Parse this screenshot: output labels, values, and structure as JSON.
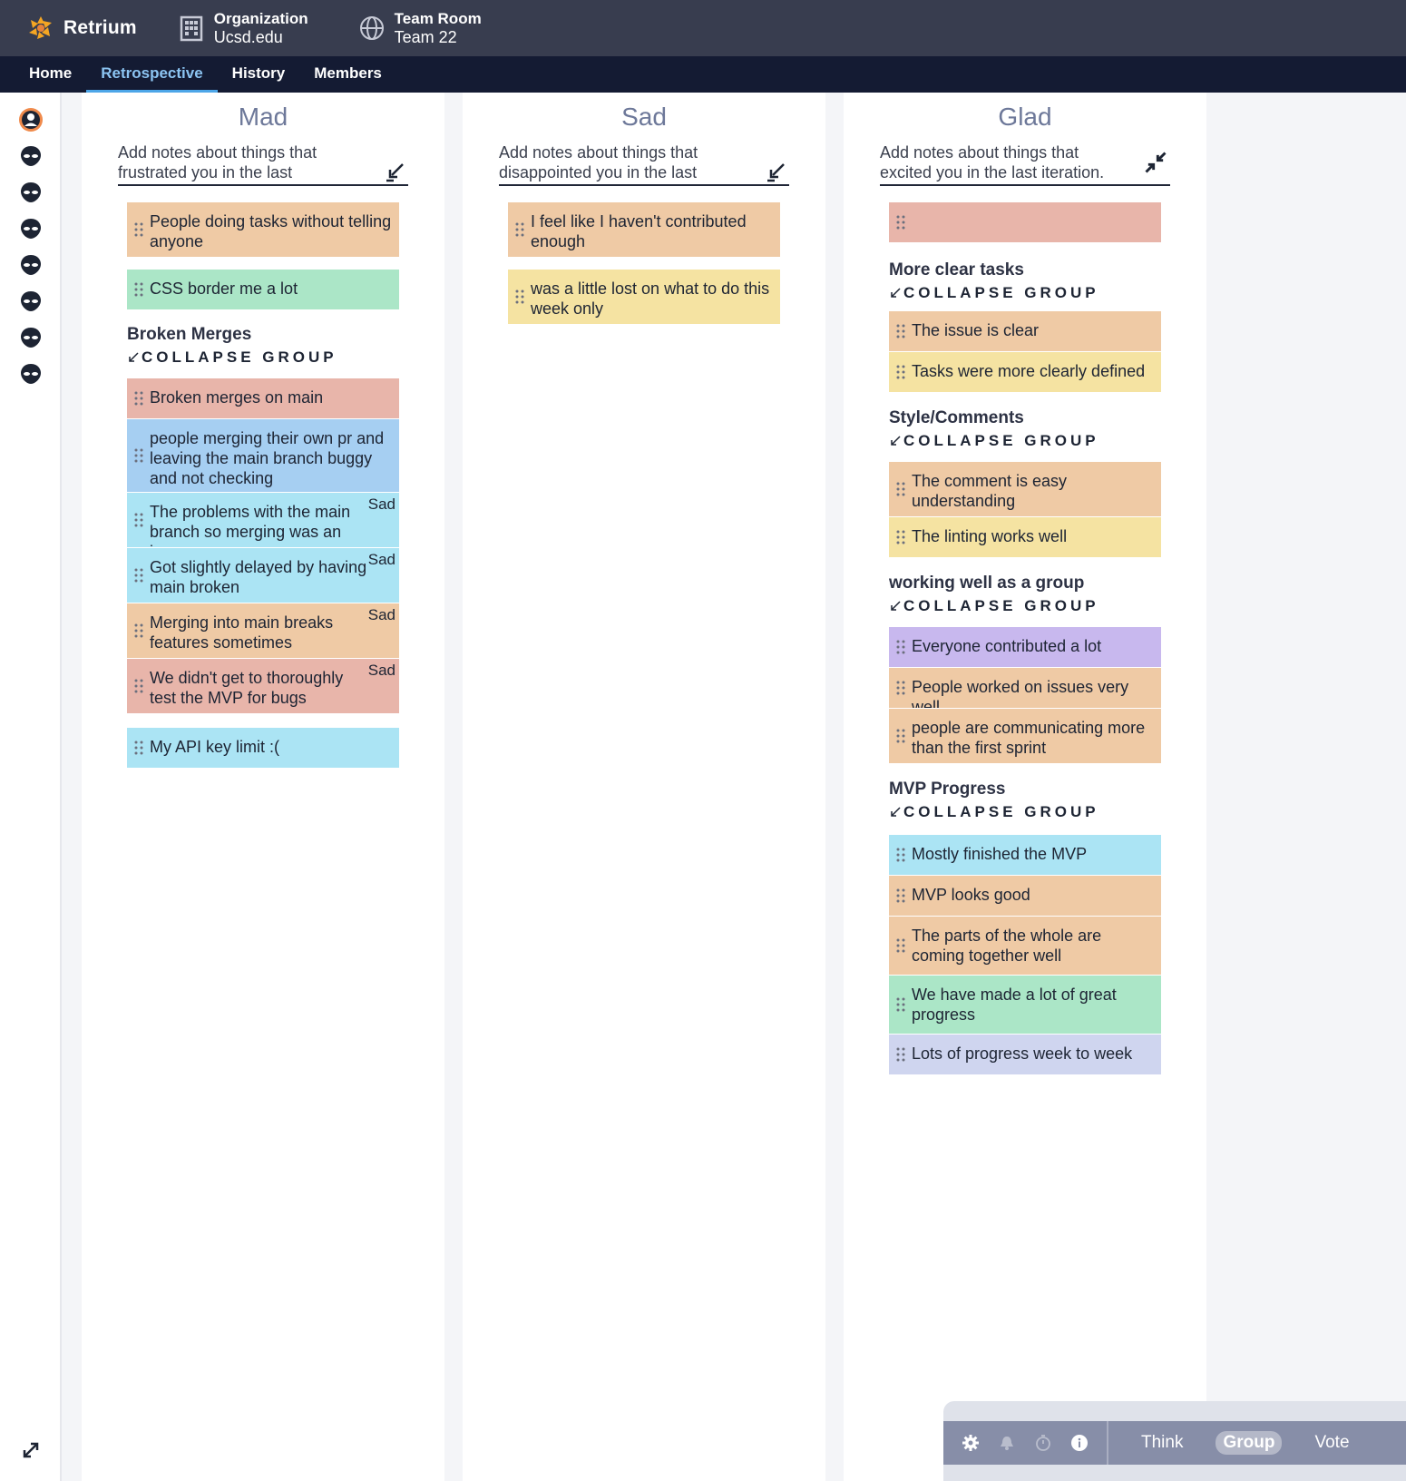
{
  "app": {
    "name": "Retrium",
    "accent": "#f5a623"
  },
  "breadcrumb": {
    "organization": {
      "label": "Organization",
      "value": "Ucsd.edu"
    },
    "team_room": {
      "label": "Team Room",
      "value": "Team 22"
    }
  },
  "nav": {
    "items": [
      "Home",
      "Retrospective",
      "History",
      "Members"
    ],
    "active": "Retrospective"
  },
  "sidebar": {
    "avatar_count": 8
  },
  "columns": {
    "mad": {
      "title": "Mad",
      "input": "Add notes about things that frustrated you in the last",
      "cards": {
        "c1": "People doing tasks without telling anyone",
        "c2": "CSS border me a lot",
        "group1": {
          "title": "Broken Merges",
          "collapse": "COLLAPSE GROUP",
          "items": [
            {
              "text": "Broken merges on main",
              "tag": ""
            },
            {
              "text": "people merging their own pr and leaving the main branch buggy and not checking",
              "tag": ""
            },
            {
              "text": "The problems with the main branch so merging was an issue",
              "tag": "Sad"
            },
            {
              "text": "Got slightly delayed by having main broken",
              "tag": "Sad"
            },
            {
              "text": "Merging into main breaks features sometimes",
              "tag": "Sad"
            },
            {
              "text": "We didn't get to thoroughly test the MVP for bugs",
              "tag": "Sad"
            }
          ]
        },
        "c3": "My API key limit :("
      }
    },
    "sad": {
      "title": "Sad",
      "input": "Add notes about things that disappointed you in the last",
      "cards": {
        "c1": "I feel like I haven't contributed enough",
        "c2": "was a little lost on what to do this week only"
      }
    },
    "glad": {
      "title": "Glad",
      "input": "Add notes about things that excited you in the last iteration.",
      "cards": {
        "empty": "",
        "group1": {
          "title": "More clear tasks",
          "collapse": "COLLAPSE GROUP",
          "items": [
            "The issue is clear",
            "Tasks were more clearly defined"
          ]
        },
        "group2": {
          "title": "Style/Comments",
          "collapse": "COLLAPSE GROUP",
          "items": [
            "The comment is easy understanding",
            "The linting works well"
          ]
        },
        "group3": {
          "title": "working well as a group",
          "collapse": "COLLAPSE GROUP",
          "items": [
            "Everyone contributed a lot",
            "People worked on issues very well",
            "people are communicating more than the first sprint"
          ]
        },
        "group4": {
          "title": "MVP Progress",
          "collapse": "COLLAPSE GROUP",
          "items": [
            "Mostly finished the MVP",
            "MVP looks good",
            "The parts of the whole are coming together well",
            "We have made a lot of great progress",
            "Lots of progress week to week"
          ]
        }
      }
    }
  },
  "phasebar": {
    "icons": [
      "gear-icon",
      "bell-icon",
      "timer-icon",
      "info-icon"
    ],
    "steps": [
      "Think",
      "Group",
      "Vote"
    ],
    "active": "Group"
  }
}
